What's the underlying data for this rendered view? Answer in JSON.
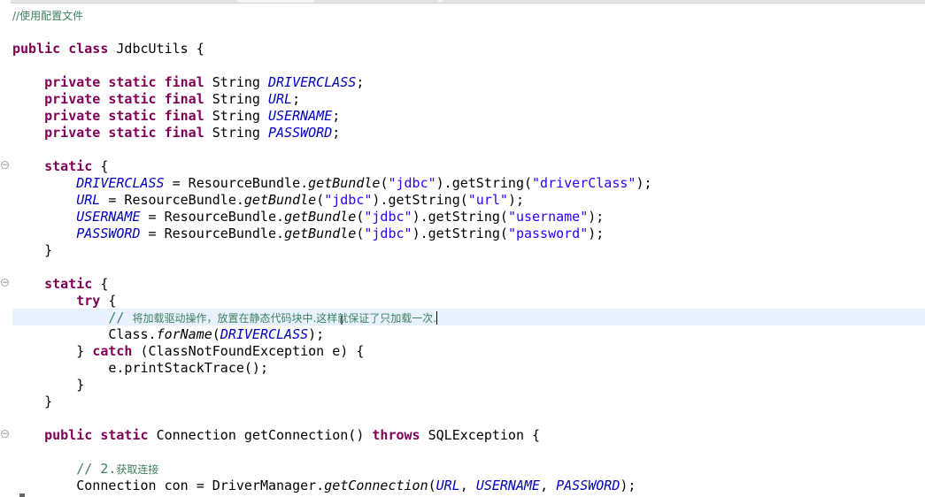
{
  "editor": {
    "comment_config": "//使用配置文件",
    "code": {
      "l_public": "public",
      "l_class": "class",
      "class_name": "JdbcUtils {",
      "private": "private",
      "static": "static",
      "final": "final",
      "type_string": "String",
      "f_driverclass": "DRIVERCLASS",
      "f_url": "URL",
      "f_username": "USERNAME",
      "f_password": "PASSWORD",
      "semi": ";",
      "static_block_open": "{",
      "assign": " = ResourceBundle.",
      "getBundle": "getBundle",
      "open_paren": "(",
      "str_jdbc": "\"jdbc\"",
      "get_string": ").getString(",
      "str_driverClass": "\"driverClass\"",
      "str_url": "\"url\"",
      "str_username": "\"username\"",
      "str_password": "\"password\"",
      "close_call": ");",
      "close_brace": "}",
      "try": "try",
      "comment_load_prefix": "// ",
      "comment_load": "将加载驱动操作，放置在静态代码块中.这样就保证了只加载一次.",
      "class_forname_pre": "Class.",
      "forName": "forName",
      "forname_close": ");",
      "catch": "catch",
      "catch_rest": "(ClassNotFoundException e) {",
      "print_stack": "e.printStackTrace();",
      "connection_type": "Connection",
      "get_connection_sig": "getConnection()",
      "throws": "throws",
      "sql_exception": "SQLException {",
      "comment_step2_prefix": "// 2.",
      "comment_step2": "获取连接",
      "con_decl": "Connection con = DriverManager.",
      "getConnection": "getConnection",
      "comma": ", ",
      "close_paren_semi": ");"
    }
  }
}
